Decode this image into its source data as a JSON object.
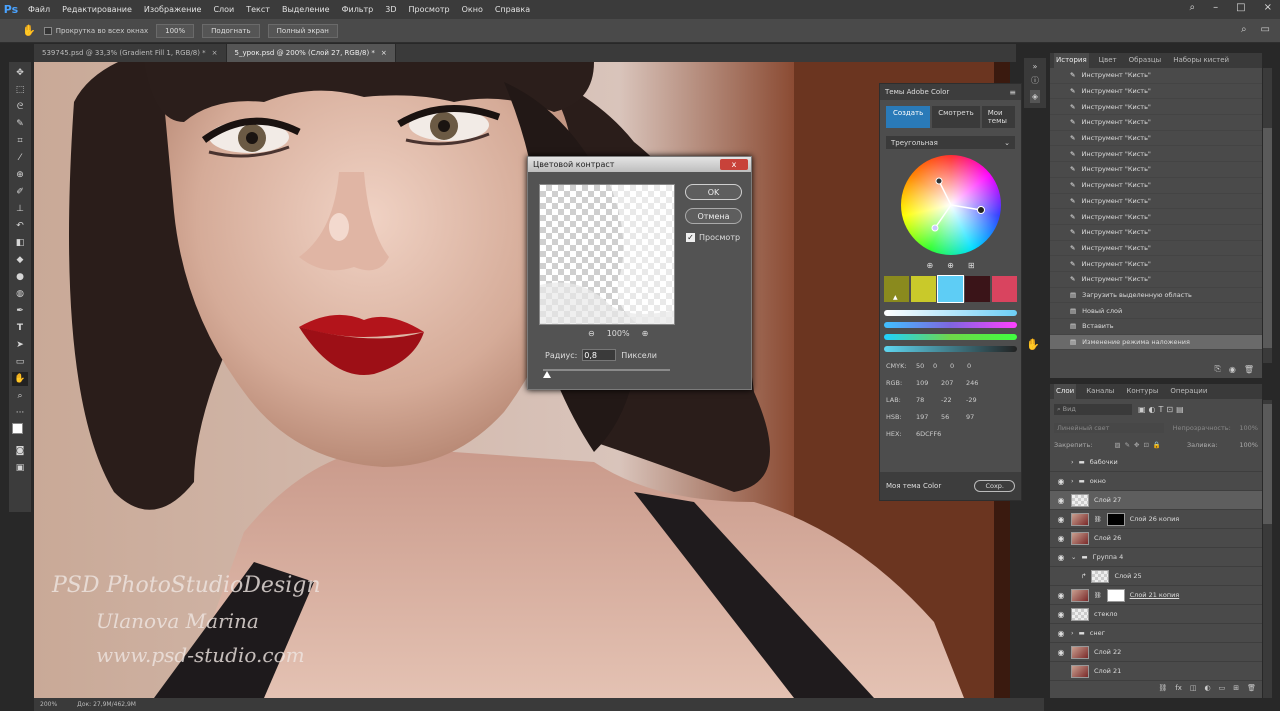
{
  "app": {
    "logo": "Ps"
  },
  "menu": [
    "Файл",
    "Редактирование",
    "Изображение",
    "Слои",
    "Текст",
    "Выделение",
    "Фильтр",
    "3D",
    "Просмотр",
    "Окно",
    "Справка"
  ],
  "window_controls": {
    "minimize": "–",
    "maximize": "□",
    "close": "×"
  },
  "options_bar": {
    "scroll_all_label": "Прокрутка во всех окнах",
    "zoom_value": "100%",
    "fit_label": "Подогнать",
    "fullscreen_label": "Полный экран"
  },
  "tabs": [
    {
      "label": "539745.psd @ 33,3% (Gradient Fill 1, RGB/8) *",
      "close": "×"
    },
    {
      "label": "5_урок.psd @ 200% (Слой 27, RGB/8) *",
      "close": "×"
    }
  ],
  "canvas": {
    "watermark_line1": "PSD PhotoStudioDesign",
    "watermark_line2": "Ulanova Marina",
    "watermark_line3": "www.psd-studio.com"
  },
  "status": {
    "zoom": "200%",
    "doc": "Док: 27,9М/462,9М"
  },
  "dialog": {
    "title": "Цветовой контраст",
    "close": "x",
    "ok_label": "OK",
    "cancel_label": "Отмена",
    "preview_label": "Просмотр",
    "preview_checked": true,
    "zoom": "100%",
    "radius_label": "Радиус:",
    "radius_value": "0,8",
    "unit_label": "Пиксели"
  },
  "color_themes": {
    "title": "Темы Adobe Color",
    "tabs": [
      "Создать",
      "Смотреть",
      "Мои темы"
    ],
    "rule": "Треугольная",
    "swatches": [
      "#8a8a1e",
      "#c9c92a",
      "#5ecdf5",
      "#3a1418",
      "#d9445f"
    ],
    "sliders": [
      "#6dcff6",
      "#7f66e0",
      "#6fd74a",
      "#5fd6f0"
    ],
    "cmyk": {
      "label": "CMYK:",
      "values": [
        "50",
        "0",
        "0",
        "0"
      ]
    },
    "rgb": {
      "label": "RGB:",
      "values": [
        "109",
        "207",
        "246"
      ]
    },
    "lab": {
      "label": "LAB:",
      "values": [
        "78",
        "-22",
        "-29"
      ]
    },
    "hsb": {
      "label": "HSB:",
      "values": [
        "197",
        "56",
        "97"
      ]
    },
    "hex": {
      "label": "HEX:",
      "value": "6DCFF6"
    },
    "my_theme": "Моя тема Color",
    "save_label": "Сохр."
  },
  "history": {
    "tabs": [
      "История",
      "Цвет",
      "Образцы",
      "Наборы кистей"
    ],
    "items": [
      "Инструмент \"Кисть\"",
      "Инструмент \"Кисть\"",
      "Инструмент \"Кисть\"",
      "Инструмент \"Кисть\"",
      "Инструмент \"Кисть\"",
      "Инструмент \"Кисть\"",
      "Инструмент \"Кисть\"",
      "Инструмент \"Кисть\"",
      "Инструмент \"Кисть\"",
      "Инструмент \"Кисть\"",
      "Инструмент \"Кисть\"",
      "Инструмент \"Кисть\"",
      "Инструмент \"Кисть\"",
      "Инструмент \"Кисть\"",
      "Загрузить выделенную область",
      "Новый слой",
      "Вставить",
      "Изменение режима наложения"
    ]
  },
  "layers": {
    "tabs": [
      "Слои",
      "Каналы",
      "Контуры",
      "Операции"
    ],
    "filter_placeholder": "Вид",
    "blend_mode": "Линейный свет",
    "opacity_label": "Непрозрачность:",
    "opacity_value": "100%",
    "lock_label": "Закрепить:",
    "fill_label": "Заливка:",
    "fill_value": "100%",
    "items": [
      {
        "name": "бабочки",
        "type": "group",
        "visible": false
      },
      {
        "name": "окно",
        "type": "group",
        "visible": true
      },
      {
        "name": "Слой 27",
        "type": "layer",
        "visible": true,
        "selected": true
      },
      {
        "name": "Слой 26 копия",
        "type": "layer-mask",
        "visible": true
      },
      {
        "name": "Слой 26",
        "type": "layer",
        "visible": true
      },
      {
        "name": "Группа 4",
        "type": "group-open",
        "visible": true
      },
      {
        "name": "Слой 25",
        "type": "layer-clip",
        "visible": false
      },
      {
        "name": "Слой 21 копия",
        "type": "layer-mask",
        "visible": true
      },
      {
        "name": "стекло",
        "type": "layer",
        "visible": true
      },
      {
        "name": "снег",
        "type": "group",
        "visible": true
      },
      {
        "name": "Слой 22",
        "type": "layer",
        "visible": true
      },
      {
        "name": "Слой 21",
        "type": "layer",
        "visible": false
      }
    ]
  }
}
